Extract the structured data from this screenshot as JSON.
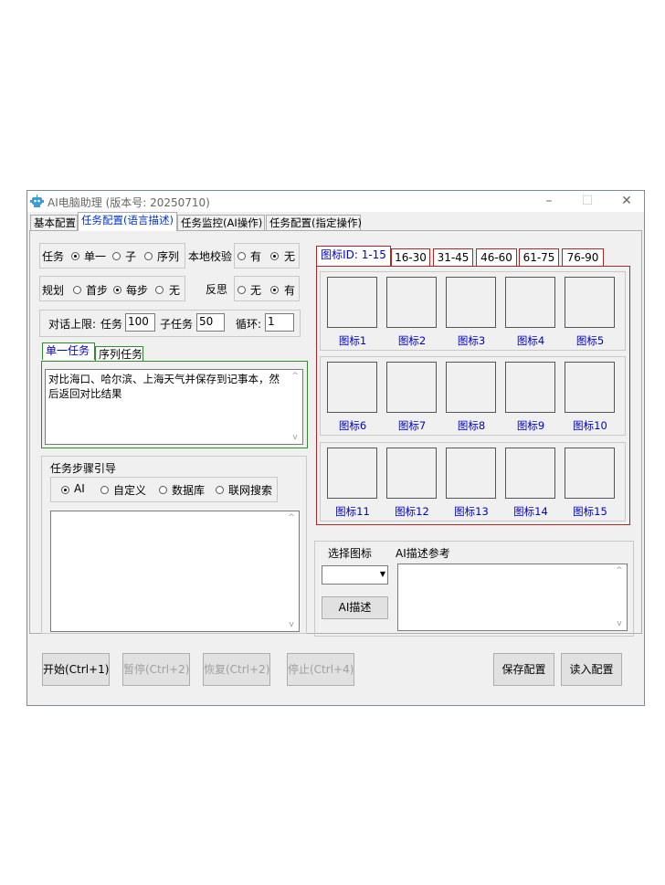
{
  "window": {
    "title": "AI电脑助理 (版本号: 20250710)",
    "minimize": "–",
    "maximize": "☐",
    "close": "✕"
  },
  "main_tabs": [
    "基本配置",
    "任务配置(语言描述)",
    "任务监控(AI操作)",
    "任务配置(指定操作)"
  ],
  "task": {
    "label": "任务",
    "options": [
      "单一",
      "子",
      "序列"
    ],
    "selected": "单一"
  },
  "local_check": {
    "label": "本地校验",
    "options": [
      "有",
      "无"
    ],
    "selected": "无"
  },
  "plan": {
    "label": "规划",
    "options": [
      "首步",
      "每步",
      "无"
    ],
    "selected": "每步"
  },
  "reflect": {
    "label": "反思",
    "options": [
      "无",
      "有"
    ],
    "selected": "有"
  },
  "limits": {
    "label": "对话上限:",
    "task_label": "任务",
    "task_value": "100",
    "subtask_label": "子任务",
    "subtask_value": "50",
    "loop_label": "循环:",
    "loop_value": "1"
  },
  "task_tabs": [
    "单一任务",
    "序列任务"
  ],
  "task_text": "对比海口、哈尔滨、上海天气并保存到记事本，然后返回对比结果",
  "step_guide": {
    "label": "任务步骤引导",
    "options": [
      "AI",
      "自定义",
      "数据库",
      "联网搜索"
    ],
    "selected": "AI",
    "text": ""
  },
  "icon_tabs": [
    "图标ID: 1-15",
    "16-30",
    "31-45",
    "46-60",
    "61-75",
    "76-90"
  ],
  "icons": [
    "图标1",
    "图标2",
    "图标3",
    "图标4",
    "图标5",
    "图标6",
    "图标7",
    "图标8",
    "图标9",
    "图标10",
    "图标11",
    "图标12",
    "图标13",
    "图标14",
    "图标15"
  ],
  "select_icon": {
    "label": "选择图标",
    "value": "",
    "ai_desc_button": "AI描述"
  },
  "ai_desc_ref": {
    "label": "AI描述参考",
    "text": ""
  },
  "buttons": {
    "start": "开始(Ctrl+1)",
    "pause": "暂停(Ctrl+2)",
    "resume": "恢复(Ctrl+2)",
    "stop": "停止(Ctrl+4)",
    "save": "保存配置",
    "load": "读入配置"
  },
  "colors": {
    "accent_blue": "#0000cc",
    "icon_frame": "#a52a2a",
    "task_tab_frame": "#2e8b2e"
  }
}
